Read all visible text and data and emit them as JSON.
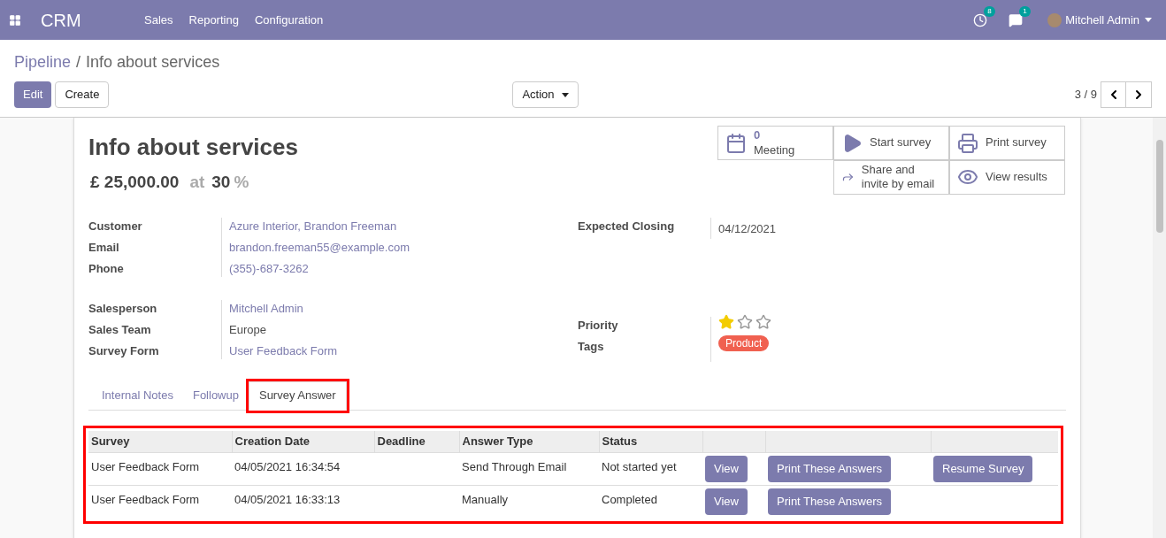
{
  "navbar": {
    "app": "CRM",
    "menu": [
      "Sales",
      "Reporting",
      "Configuration"
    ],
    "activity_count": "8",
    "message_count": "1",
    "user": "Mitchell Admin"
  },
  "breadcrumb": {
    "parent": "Pipeline",
    "separator": "/",
    "current": "Info about services"
  },
  "buttons": {
    "edit": "Edit",
    "create": "Create",
    "action": "Action"
  },
  "pager": "3 / 9",
  "record": {
    "title": "Info about services",
    "revenue": "£ 25,000.00",
    "at": "at",
    "probability": "30",
    "percent": "%"
  },
  "smart_buttons": [
    {
      "kind": "calendar",
      "value": "0",
      "label": "Meeting"
    },
    {
      "kind": "play",
      "label": "Start survey"
    },
    {
      "kind": "print",
      "label": "Print survey"
    },
    {
      "kind": "share",
      "label": "Share and invite by email"
    },
    {
      "kind": "eye",
      "label": "View results"
    }
  ],
  "left_fields": [
    [
      {
        "label": "Customer",
        "value": "Azure Interior, Brandon Freeman",
        "link": true
      },
      {
        "label": "Email",
        "value": "brandon.freeman55@example.com",
        "link": true
      },
      {
        "label": "Phone",
        "value": "(355)-687-3262",
        "link": true
      }
    ],
    [
      {
        "label": "Salesperson",
        "value": "Mitchell Admin",
        "link": true
      },
      {
        "label": "Sales Team",
        "value": "Europe",
        "link": false
      },
      {
        "label": "Survey Form",
        "value": "User Feedback Form",
        "link": true
      }
    ]
  ],
  "expected_closing": {
    "label": "Expected Closing",
    "value": "04/12/2021"
  },
  "priority": {
    "label": "Priority",
    "stars": 1
  },
  "tags": {
    "label": "Tags",
    "items": [
      {
        "name": "Product",
        "color": "#f06050"
      }
    ]
  },
  "tabs": [
    {
      "label": "Internal Notes",
      "selected": false,
      "highlighted": false
    },
    {
      "label": "Followup",
      "selected": false,
      "highlighted": false
    },
    {
      "label": "Survey Answer",
      "selected": true,
      "highlighted": true
    }
  ],
  "table": {
    "highlighted": true,
    "columns": [
      "Survey",
      "Creation Date",
      "Deadline",
      "Answer Type",
      "Status"
    ],
    "rows": [
      {
        "cells": [
          "User Feedback Form",
          "04/05/2021 16:34:54",
          "",
          "Send Through Email",
          "Not started yet"
        ],
        "actions": [
          "View",
          "Print These Answers",
          "Resume Survey"
        ]
      },
      {
        "cells": [
          "User Feedback Form",
          "04/05/2021 16:33:13",
          "",
          "Manually",
          "Completed"
        ],
        "actions": [
          "View",
          "Print These Answers"
        ]
      }
    ]
  }
}
